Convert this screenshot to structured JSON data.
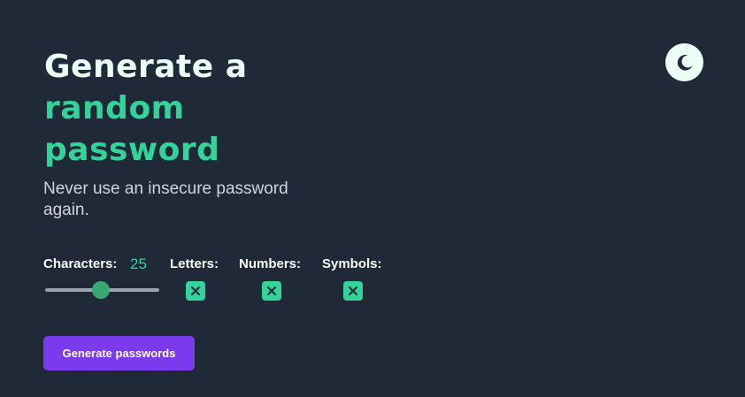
{
  "header": {
    "title_line1": "Generate a",
    "title_accent_line2": "random",
    "title_accent_line3": "password",
    "subtitle": "Never use an insecure password again."
  },
  "theme_toggle": {
    "icon": "moon-icon"
  },
  "options": {
    "characters_label": "Characters:",
    "characters_value": "25",
    "characters_fraction": 0.49,
    "letters_label": "Letters:",
    "letters_checked": true,
    "numbers_label": "Numbers:",
    "numbers_checked": true,
    "symbols_label": "Symbols:",
    "symbols_checked": true
  },
  "actions": {
    "generate_label": "Generate passwords"
  },
  "colors": {
    "background": "#1f2937",
    "accent_green": "#34d399",
    "button_purple": "#7c3aed",
    "heading_white": "#ecfdf5"
  }
}
